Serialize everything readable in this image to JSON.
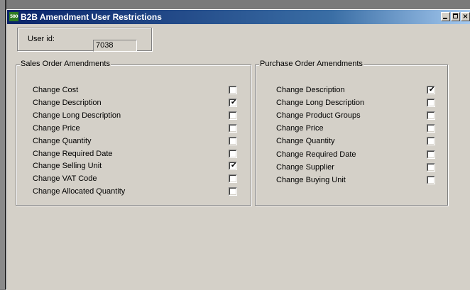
{
  "window": {
    "title": "B2B Amendment User Restrictions",
    "icon_text": "500",
    "controls": {
      "minimize": "",
      "maximize": "",
      "close": "×"
    }
  },
  "user": {
    "label": "User id:",
    "value": "7038"
  },
  "sales": {
    "title": "Sales Order Amendments",
    "items": [
      {
        "label": "Change Cost",
        "checked": false
      },
      {
        "label": "Change Description",
        "checked": true
      },
      {
        "label": "Change Long Description",
        "checked": false
      },
      {
        "label": "Change Price",
        "checked": false
      },
      {
        "label": "Change Quantity",
        "checked": false
      },
      {
        "label": "Change Required Date",
        "checked": false
      },
      {
        "label": "Change Selling Unit",
        "checked": true
      },
      {
        "label": "Change VAT Code",
        "checked": false
      },
      {
        "label": "Change Allocated Quantity",
        "checked": false
      }
    ]
  },
  "purchase": {
    "title": "Purchase Order Amendments",
    "items": [
      {
        "label": "Change Description",
        "checked": true
      },
      {
        "label": "Change Long Description",
        "checked": false
      },
      {
        "label": "Change Product Groups",
        "checked": false
      },
      {
        "label": "Change Price",
        "checked": false
      },
      {
        "label": "Change Quantity",
        "checked": false
      },
      {
        "label": "Change Required Date",
        "checked": false
      },
      {
        "label": "Change Supplier",
        "checked": false
      },
      {
        "label": "Change Buying Unit",
        "checked": false
      }
    ]
  },
  "check_glyph": "✔"
}
